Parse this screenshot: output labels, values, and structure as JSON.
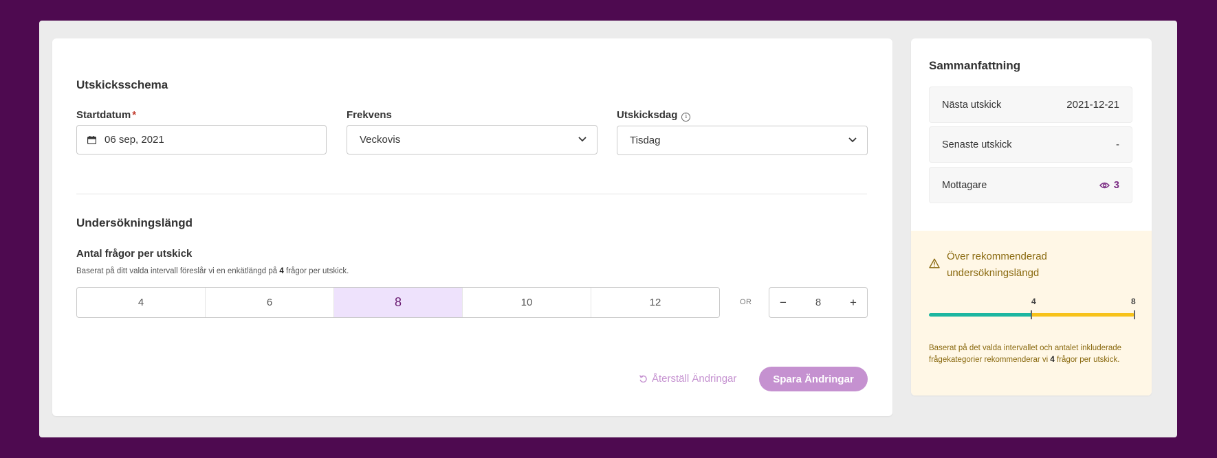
{
  "schedule": {
    "section_title": "Utskicksschema",
    "start_label": "Startdatum",
    "required_mark": "*",
    "start_value": "06 sep, 2021",
    "frequency_label": "Frekvens",
    "frequency_value": "Veckovis",
    "day_label": "Utskicksdag",
    "day_value": "Tisdag"
  },
  "length": {
    "section_title": "Undersökningslängd",
    "questions_label": "Antal frågor per utskick",
    "helper_prefix": "Baserat på ditt valda intervall föreslår vi en enkätlängd på ",
    "helper_count": "4",
    "helper_suffix": " frågor per utskick.",
    "options": [
      "4",
      "6",
      "8",
      "10",
      "12"
    ],
    "selected_index": 2,
    "or_text": "OR",
    "stepper_minus": "−",
    "stepper_value": "8",
    "stepper_plus": "+"
  },
  "actions": {
    "reset_label": "Återställ Ändringar",
    "save_label": "Spara Ändringar"
  },
  "summary": {
    "title": "Sammanfattning",
    "rows": [
      {
        "label": "Nästa utskick",
        "value": "2021-12-21"
      },
      {
        "label": "Senaste utskick",
        "value": "-"
      },
      {
        "label": "Mottagare",
        "value": "3"
      }
    ]
  },
  "warning": {
    "title": "Över rekommenderad undersökningslängd",
    "recommended": 4,
    "max": 8,
    "recommended_label": "4",
    "max_label": "8",
    "note_prefix": "Baserat på det valda intervallet och antalet inkluderade frågekategorier rekommenderar vi ",
    "note_count": "4",
    "note_suffix": " frågor per utskick."
  },
  "colors": {
    "background": "#4e0a50",
    "accent": "#c591d0",
    "selected_bg": "#eee2fc",
    "teal": "#1cb6a0",
    "yellow": "#f7c21a",
    "warning_bg": "#fff7e6"
  },
  "icons": {
    "start": "calendar-icon",
    "info": "info-icon",
    "dropdown": "chevron-down-icon",
    "reset": "undo-icon",
    "recipients": "eye-icon",
    "warning": "warning-triangle-icon"
  }
}
